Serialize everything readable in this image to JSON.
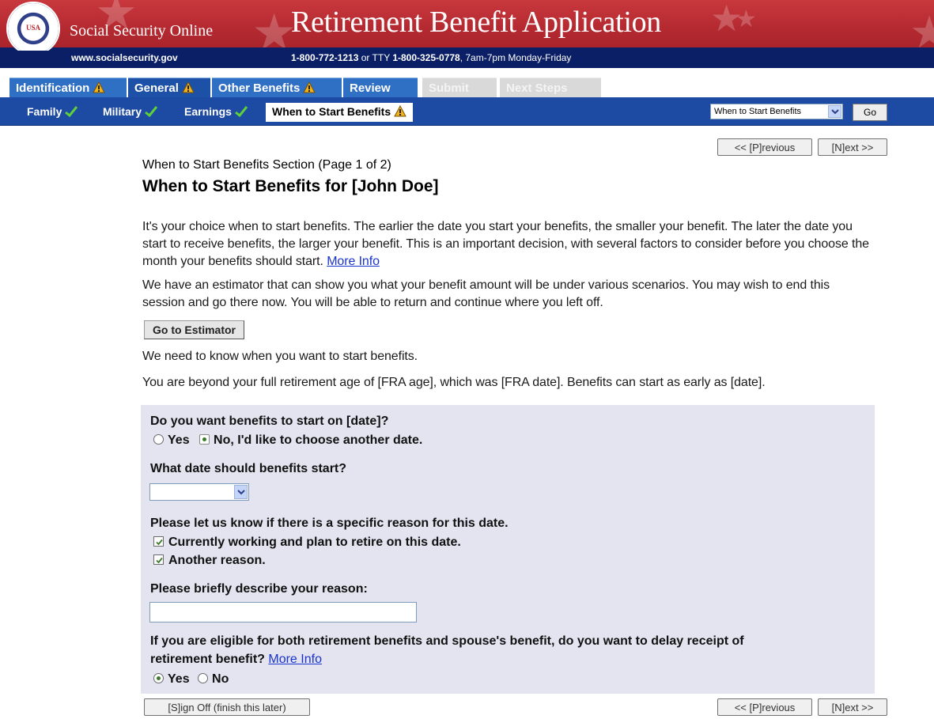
{
  "banner": {
    "seal_text": "USA",
    "site_name": "Social Security Online",
    "app_title": "Retirement Benefit Application"
  },
  "contact": {
    "url": "www.socialsecurity.gov",
    "phone_main": "1-800-772-1213",
    "phone_or": " or TTY ",
    "phone_tty": "1-800-325-0778",
    "hours": ", 7am-7pm Monday-Friday"
  },
  "tabs": [
    {
      "label": "Identification",
      "status": "warning"
    },
    {
      "label": "General",
      "status": "warning"
    },
    {
      "label": "Other Benefits",
      "status": "warning"
    },
    {
      "label": "Review",
      "status": "none"
    },
    {
      "label": "Submit",
      "status": "disabled"
    },
    {
      "label": "Next Steps",
      "status": "disabled"
    }
  ],
  "subnav": {
    "items": [
      {
        "label": "Family",
        "status": "complete"
      },
      {
        "label": "Military",
        "status": "complete"
      },
      {
        "label": "Earnings",
        "status": "complete"
      },
      {
        "label": "When to Start Benefits",
        "status": "warning"
      }
    ],
    "section_select_value": "When to Start Benefits",
    "go_label": "Go"
  },
  "nav": {
    "previous": "<< [P]revious",
    "next": "[N]ext >>",
    "sign_off": "[S]ign Off (finish this later)"
  },
  "content": {
    "section_label": "When to Start Benefits Section (Page 1 of 2)",
    "heading": "When to Start Benefits for [John Doe]",
    "intro": "It's your choice when to start benefits. The earlier the date you start your benefits, the smaller your benefit. The later the date you start to receive benefits, the larger your benefit. This is an important decision, with several factors to consider before you choose the month your benefits should start.",
    "more_info": "More Info",
    "estimator_text": "We have an estimator that can show you what your benefit amount will be under various scenarios. You may wish to end this session and go there now. You will be able to return and continue where you left off.",
    "estimator_button": "Go to Estimator",
    "need_to_know": "We need to know when you want to start benefits.",
    "fra_text": "You are beyond your full retirement age of [FRA age], which was [FRA date]. Benefits can start as early as [date]."
  },
  "questions": {
    "q1": {
      "label": "Do you want benefits to start on [date]?",
      "yes": "Yes",
      "no": "No, I'd like to choose another date.",
      "selected": "no"
    },
    "q2": {
      "label": "What date should benefits start?",
      "value": ""
    },
    "q3": {
      "label": "Please let us know if there is a specific reason for this date.",
      "options": [
        {
          "label": "Currently working and plan to retire on this date.",
          "checked": true
        },
        {
          "label": "Another reason.",
          "checked": true
        }
      ]
    },
    "q4": {
      "label": "Please briefly describe your reason:",
      "value": ""
    },
    "q5": {
      "label_line1": "If you are eligible for both retirement benefits and spouse's benefit, do you want to delay receipt of",
      "label_line2": "retirement benefit?",
      "more_info": "More Info",
      "yes": "Yes",
      "no": "No",
      "selected": "yes"
    }
  },
  "colors": {
    "banner_red": "#b52a31",
    "navy": "#0b1f66",
    "tab_blue": "#2f6fc4",
    "subnav_blue": "#1d4aa2",
    "question_bg": "#e3e4f0",
    "link": "#1a33cc"
  }
}
